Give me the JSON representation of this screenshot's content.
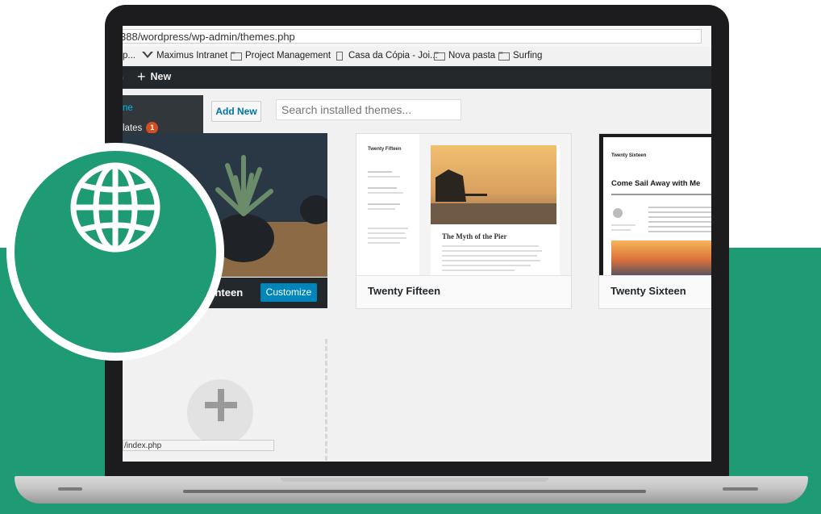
{
  "browser": {
    "address": "388/wordpress/wp-admin/themes.php",
    "bookmarks": [
      "p...",
      "Maximus Intranet",
      "Project Management",
      "Casa da Cópia - Joi...",
      "Nova pasta",
      "Surfing"
    ]
  },
  "adminbar": {
    "new_label": "New"
  },
  "sidebar": {
    "item_1": "ne",
    "item_2": "lates",
    "updates_badge": "1"
  },
  "toolbar": {
    "add_new_label": "Add New",
    "search_placeholder": "Search installed themes..."
  },
  "themes": [
    {
      "name": "venteen",
      "active": true,
      "action_label": "Customize"
    },
    {
      "name": "Twenty Fifteen",
      "preview_heading": "The Myth of the Pier",
      "preview_site_title": "Twenty Fifteen"
    },
    {
      "name": "Twenty Sixteen",
      "preview_heading": "Come Sail Away with Me",
      "preview_site_title": "Twenty Sixteen"
    }
  ],
  "status_bar": {
    "url": "/index.php"
  },
  "colors": {
    "brand_green": "#1e9a75",
    "wp_blue": "#0085ba",
    "admin_bar": "#23282d"
  },
  "icons": {
    "overlay": "globe-icon",
    "add_theme": "plus-icon"
  }
}
